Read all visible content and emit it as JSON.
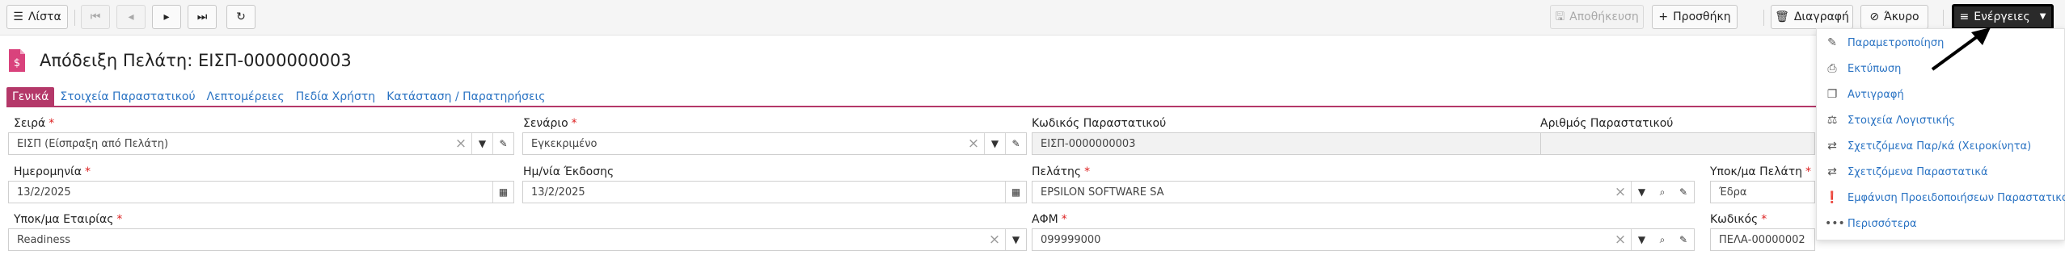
{
  "toolbar": {
    "list_label": "Λίστα",
    "save_label": "Αποθήκευση",
    "add_label": "Προσθήκη",
    "delete_label": "Διαγραφή",
    "cancel_label": "Άκυρο",
    "actions_label": "Ενέργειες"
  },
  "header": {
    "title": "Απόδειξη Πελάτη: ΕΙΣΠ-0000000003"
  },
  "tabs": [
    {
      "label": "Γενικά"
    },
    {
      "label": "Στοιχεία Παραστατικού"
    },
    {
      "label": "Λεπτομέρειες"
    },
    {
      "label": "Πεδία Χρήστη"
    },
    {
      "label": "Κατάσταση / Παρατηρήσεις"
    }
  ],
  "form": {
    "series": {
      "label": "Σειρά",
      "value": "ΕΙΣΠ (Είσπραξη από Πελάτη)"
    },
    "scenario": {
      "label": "Σενάριο",
      "value": "Εγκεκριμένο"
    },
    "doc_code": {
      "label": "Κωδικός Παραστατικού",
      "value": "ΕΙΣΠ-0000000003"
    },
    "doc_number": {
      "label": "Αριθμός Παραστατικού",
      "value": ""
    },
    "date": {
      "label": "Ημερομηνία",
      "value": "13/2/2025"
    },
    "issue_date": {
      "label": "Ημ/νία Έκδοσης",
      "value": "13/2/2025"
    },
    "customer": {
      "label": "Πελάτης",
      "value": "EPSILON SOFTWARE SA"
    },
    "customer_branch": {
      "label": "Υποκ/μα Πελάτη",
      "value": "Έδρα"
    },
    "company_branch": {
      "label": "Υποκ/μα Εταιρίας",
      "value": "Readiness"
    },
    "vat": {
      "label": "ΑΦΜ",
      "value": "099999000"
    },
    "code": {
      "label": "Κωδικός",
      "value": "ΠΕΛΑ-00000002"
    }
  },
  "actions_menu": [
    {
      "label": "Παραμετροποίηση",
      "icon": "pencil-icon"
    },
    {
      "label": "Εκτύπωση",
      "icon": "printer-icon"
    },
    {
      "label": "Αντιγραφή",
      "icon": "copy-icon"
    },
    {
      "label": "Στοιχεία Λογιστικής",
      "icon": "balance-icon"
    },
    {
      "label": "Σχετιζόμενα Παρ/κά (Χειροκίνητα)",
      "icon": "swap-icon"
    },
    {
      "label": "Σχετιζόμενα Παραστατικά",
      "icon": "swap-icon"
    },
    {
      "label": "Εμφάνιση Προειδοποιήσεων Παραστατικού",
      "icon": "warning-icon"
    },
    {
      "label": "Περισσότερα",
      "icon": "more-icon"
    }
  ],
  "colors": {
    "accent": "#b43869",
    "link": "#2a73c3",
    "required": "#dd2222"
  }
}
